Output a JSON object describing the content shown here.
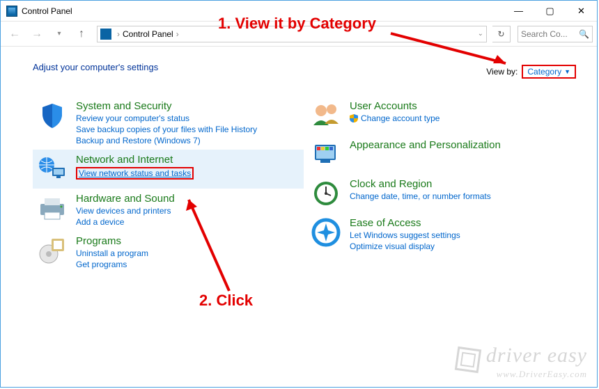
{
  "window": {
    "title": "Control Panel"
  },
  "toolbar": {
    "breadcrumb": "Control Panel",
    "search_placeholder": "Search Co..."
  },
  "heading": "Adjust your computer's settings",
  "viewby": {
    "label": "View by:",
    "value": "Category"
  },
  "left": [
    {
      "title": "System and Security",
      "links": [
        "Review your computer's status",
        "Save backup copies of your files with File History",
        "Backup and Restore (Windows 7)"
      ]
    },
    {
      "title": "Network and Internet",
      "links": [
        "View network status and tasks"
      ]
    },
    {
      "title": "Hardware and Sound",
      "links": [
        "View devices and printers",
        "Add a device"
      ]
    },
    {
      "title": "Programs",
      "links": [
        "Uninstall a program",
        "Get programs"
      ]
    }
  ],
  "right": [
    {
      "title": "User Accounts",
      "links": [
        "Change account type"
      ],
      "shield": true
    },
    {
      "title": "Appearance and Personalization",
      "links": []
    },
    {
      "title": "Clock and Region",
      "links": [
        "Change date, time, or number formats"
      ]
    },
    {
      "title": "Ease of Access",
      "links": [
        "Let Windows suggest settings",
        "Optimize visual display"
      ]
    }
  ],
  "annotations": {
    "step1": "1. View it by Category",
    "step2": "2. Click"
  },
  "watermark": {
    "brand": "driver easy",
    "url": "www.DriverEasy.com"
  }
}
